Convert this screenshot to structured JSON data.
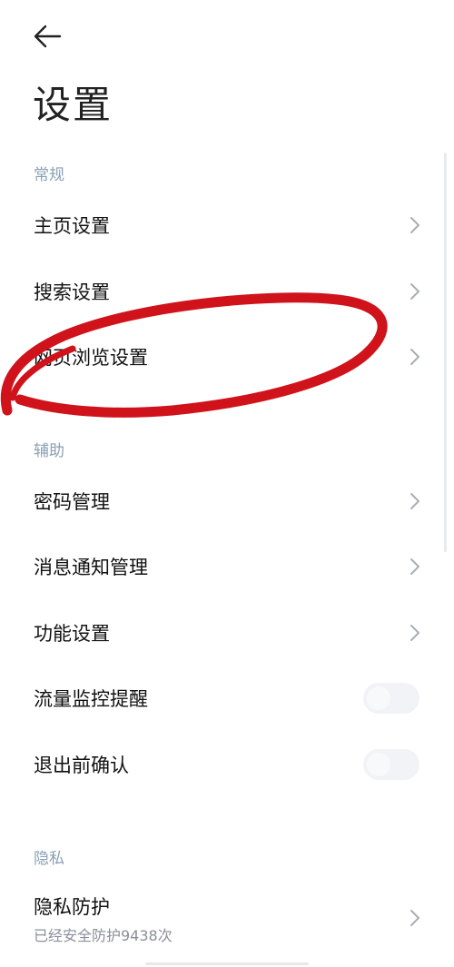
{
  "header": {
    "back_icon": "arrow-left-icon",
    "title": "设置"
  },
  "sections": {
    "general": {
      "title": "常规",
      "items": {
        "homepage": "主页设置",
        "search": "搜索设置",
        "browsing": "网页浏览设置"
      }
    },
    "assist": {
      "title": "辅助",
      "items": {
        "password": "密码管理",
        "notification": "消息通知管理",
        "features": "功能设置",
        "traffic_monitor": "流量监控提醒",
        "exit_confirm": "退出前确认"
      },
      "toggles": {
        "traffic_monitor": false,
        "exit_confirm": false
      }
    },
    "privacy": {
      "title": "隐私",
      "items": {
        "protection": "隐私防护",
        "protection_sub": "已经安全防护9438次"
      }
    }
  },
  "colors": {
    "section_header": "#8aa0b4",
    "chevron": "#a9aeb6",
    "annotation": "#d0121a"
  },
  "icons": {
    "chevron": "chevron-right-icon"
  }
}
